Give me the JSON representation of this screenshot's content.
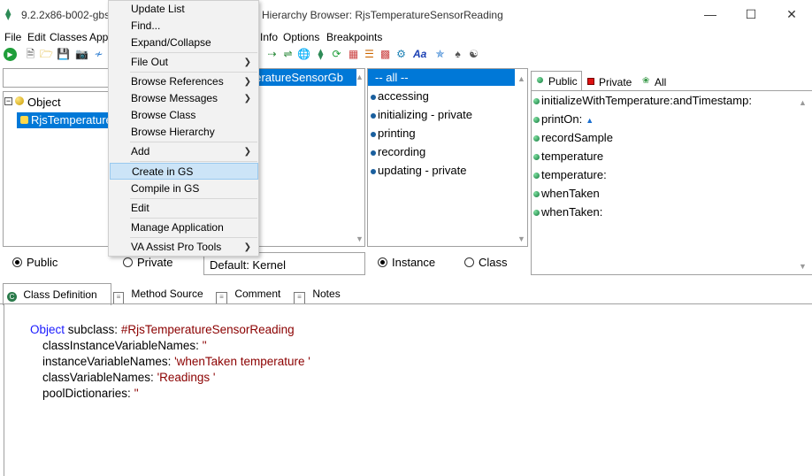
{
  "titlebar": {
    "app_title": "9.2.2x86-b002-gbs",
    "window_title": "Hierarchy Browser: RjsTemperatureSensorReading",
    "minimize": "—",
    "maximize": "☐",
    "close": "✕"
  },
  "menubar": {
    "file": "File",
    "edit": "Edit",
    "classes": "Classes",
    "app": "App",
    "info": "Info",
    "options": "Options",
    "breakpoints": "Breakpoints"
  },
  "class_tree": {
    "root": "Object",
    "child": "RjsTemperatureSensorReading"
  },
  "middle_top": {
    "selected_fragment": "peratureSensorGb"
  },
  "categories": {
    "items": [
      "-- all --",
      "accessing",
      "initializing - private",
      "printing",
      "recording",
      "updating - private"
    ]
  },
  "method_tabs": {
    "public": "Public",
    "private": "Private",
    "all": "All"
  },
  "methods": {
    "items": [
      "initializeWithTemperature:andTimestamp:",
      "printOn:",
      "recordSample",
      "temperature",
      "temperature:",
      "whenTaken",
      "whenTaken:"
    ]
  },
  "visibility": {
    "public": "Public",
    "private": "Private",
    "default_app": "Default: Kernel"
  },
  "scope": {
    "instance": "Instance",
    "class": "Class"
  },
  "bottom_tabs": {
    "class_definition": "Class Definition",
    "method_source": "Method Source",
    "comment": "Comment",
    "notes": "Notes"
  },
  "definition": {
    "line1_a": "Object",
    "line1_b": " subclass: ",
    "line1_c": "#RjsTemperatureSensorReading",
    "line2_a": "classInstanceVariableNames: ",
    "line2_b": "''",
    "line3_a": "instanceVariableNames: ",
    "line3_b": "'whenTaken temperature '",
    "line4_a": "classVariableNames: ",
    "line4_b": "'Readings '",
    "line5_a": "poolDictionaries: ",
    "line5_b": "''"
  },
  "context_menu": {
    "items": [
      {
        "label": "Update List",
        "submenu": false
      },
      {
        "label": "Find...",
        "submenu": false
      },
      {
        "label": "Expand/Collapse",
        "submenu": false
      },
      {
        "label": "File Out",
        "submenu": true
      },
      {
        "label": "Browse References",
        "submenu": true
      },
      {
        "label": "Browse Messages",
        "submenu": true
      },
      {
        "label": "Browse Class",
        "submenu": false
      },
      {
        "label": "Browse Hierarchy",
        "submenu": false
      },
      {
        "label": "Add",
        "submenu": true
      },
      {
        "label": "Create in GS",
        "submenu": false
      },
      {
        "label": "Compile in GS",
        "submenu": false
      },
      {
        "label": "Edit",
        "submenu": false
      },
      {
        "label": "Manage Application",
        "submenu": false
      },
      {
        "label": "VA Assist Pro Tools",
        "submenu": true
      }
    ],
    "highlighted": "Create in GS"
  },
  "colors": {
    "selection": "#0078d7",
    "menu_highlight": "#cce4f7",
    "code_keyword": "#1a1aff",
    "code_literal": "#8b0000"
  }
}
